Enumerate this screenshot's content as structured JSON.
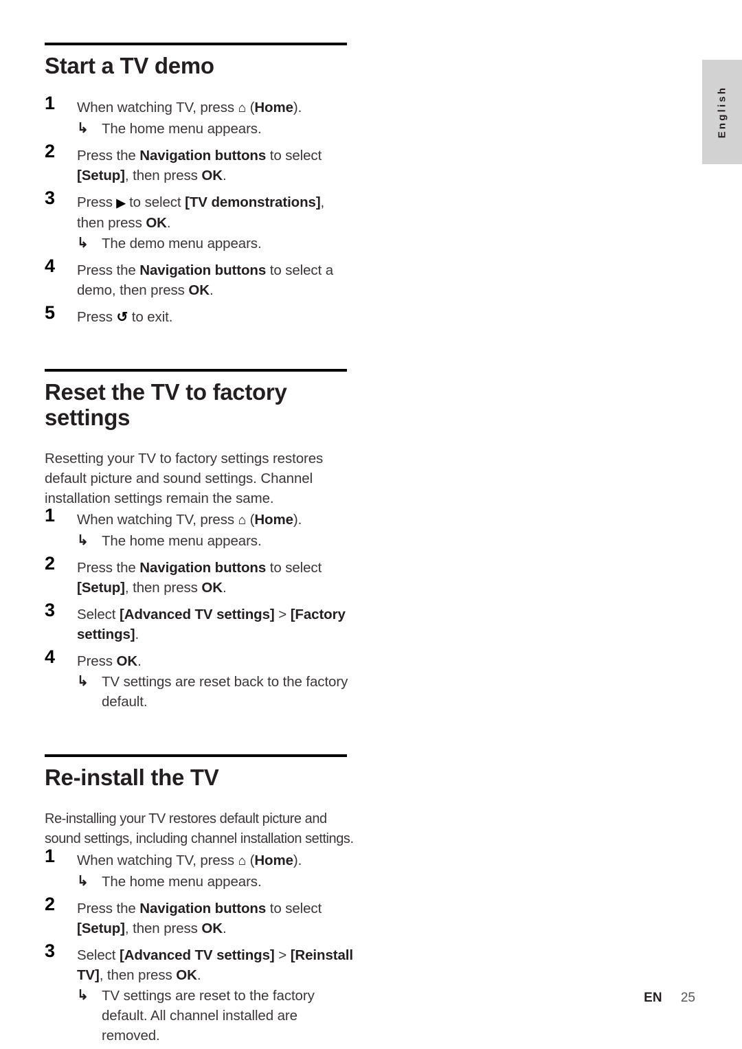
{
  "language_tab": {
    "label": "English",
    "background": "#d2d2d2"
  },
  "footer": {
    "locale": "EN",
    "page_number": "25"
  },
  "icons": {
    "home": "⌂",
    "right": "▶",
    "back": "↺",
    "result_arrow": "↳"
  },
  "sections": [
    {
      "id": "start-a-tv-demo",
      "title": "Start a TV demo",
      "intro": "",
      "steps": [
        {
          "number": "1",
          "parts": [
            {
              "t": "When watching TV, press "
            },
            {
              "icon": "home"
            },
            {
              "t": " ("
            },
            {
              "t": "Home",
              "b": true
            },
            {
              "t": ")."
            }
          ],
          "results": [
            "The home menu appears."
          ]
        },
        {
          "number": "2",
          "parts": [
            {
              "t": "Press the "
            },
            {
              "t": "Navigation buttons",
              "b": true
            },
            {
              "t": " to select "
            },
            {
              "t": "[Setup]",
              "b": true
            },
            {
              "t": ", then press "
            },
            {
              "t": "OK",
              "b": true
            },
            {
              "t": "."
            }
          ],
          "results": []
        },
        {
          "number": "3",
          "parts": [
            {
              "t": "Press "
            },
            {
              "icon": "right"
            },
            {
              "t": " to select "
            },
            {
              "t": "[TV demonstrations]",
              "b": true
            },
            {
              "t": ", then press "
            },
            {
              "t": "OK",
              "b": true
            },
            {
              "t": "."
            }
          ],
          "results": [
            "The demo menu appears."
          ]
        },
        {
          "number": "4",
          "parts": [
            {
              "t": "Press the "
            },
            {
              "t": "Navigation buttons",
              "b": true
            },
            {
              "t": " to select a demo, then press "
            },
            {
              "t": "OK",
              "b": true
            },
            {
              "t": "."
            }
          ],
          "results": []
        },
        {
          "number": "5",
          "parts": [
            {
              "t": "Press "
            },
            {
              "icon": "back"
            },
            {
              "t": " to exit."
            }
          ],
          "results": []
        }
      ]
    },
    {
      "id": "reset-the-tv-to-factory-settings",
      "title": "Reset the TV to factory settings",
      "intro": "Resetting your TV to factory settings restores default picture and sound settings. Channel installation settings remain the same.",
      "steps": [
        {
          "number": "1",
          "parts": [
            {
              "t": "When watching TV, press "
            },
            {
              "icon": "home"
            },
            {
              "t": " ("
            },
            {
              "t": "Home",
              "b": true
            },
            {
              "t": ")."
            }
          ],
          "results": [
            "The home menu appears."
          ]
        },
        {
          "number": "2",
          "parts": [
            {
              "t": "Press the "
            },
            {
              "t": "Navigation buttons",
              "b": true
            },
            {
              "t": " to select "
            },
            {
              "t": "[Setup]",
              "b": true
            },
            {
              "t": ", then press "
            },
            {
              "t": "OK",
              "b": true
            },
            {
              "t": "."
            }
          ],
          "results": []
        },
        {
          "number": "3",
          "parts": [
            {
              "t": "Select "
            },
            {
              "t": "[Advanced TV settings]",
              "b": true
            },
            {
              "t": " > "
            },
            {
              "t": "[Factory settings]",
              "b": true
            },
            {
              "t": "."
            }
          ],
          "results": []
        },
        {
          "number": "4",
          "parts": [
            {
              "t": "Press "
            },
            {
              "t": "OK",
              "b": true
            },
            {
              "t": "."
            }
          ],
          "results": [
            "TV settings are reset back to the factory default."
          ]
        }
      ]
    },
    {
      "id": "re-install-the-tv",
      "title": "Re-install the TV",
      "intro": "Re-installing your TV restores default picture and sound settings, including channel installation settings.",
      "steps": [
        {
          "number": "1",
          "parts": [
            {
              "t": "When watching TV, press "
            },
            {
              "icon": "home"
            },
            {
              "t": " ("
            },
            {
              "t": "Home",
              "b": true
            },
            {
              "t": ")."
            }
          ],
          "results": [
            "The home menu appears."
          ]
        },
        {
          "number": "2",
          "parts": [
            {
              "t": "Press the "
            },
            {
              "t": "Navigation buttons",
              "b": true
            },
            {
              "t": " to select "
            },
            {
              "t": "[Setup]",
              "b": true
            },
            {
              "t": ", then press "
            },
            {
              "t": "OK",
              "b": true
            },
            {
              "t": "."
            }
          ],
          "results": []
        },
        {
          "number": "3",
          "parts": [
            {
              "t": "Select "
            },
            {
              "t": "[Advanced TV settings]",
              "b": true
            },
            {
              "t": " > "
            },
            {
              "t": "[Reinstall TV]",
              "b": true
            },
            {
              "t": ", then press "
            },
            {
              "t": "OK",
              "b": true
            },
            {
              "t": "."
            }
          ],
          "results": [
            "TV settings are reset to the factory default. All channel installed are removed."
          ]
        }
      ]
    }
  ]
}
